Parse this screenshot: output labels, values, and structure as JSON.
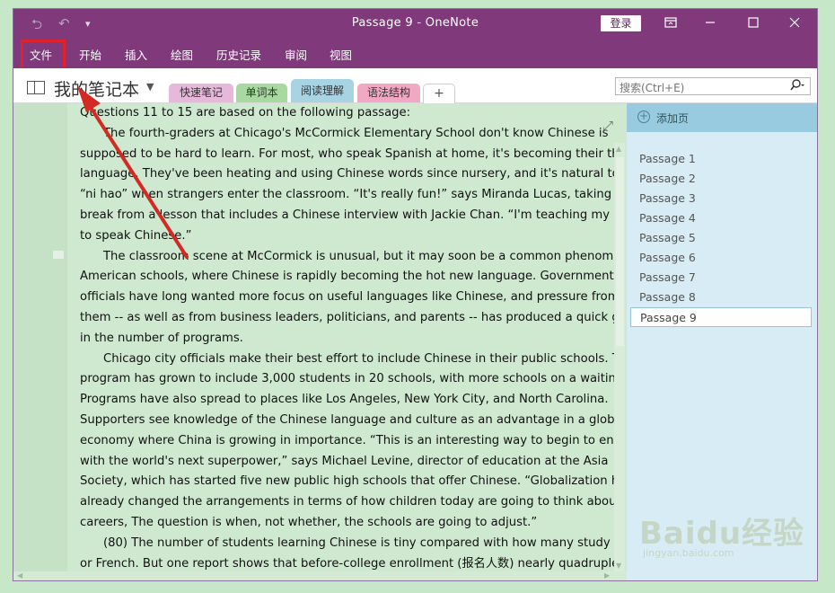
{
  "titlebar": {
    "title": "Passage 9  -  OneNote",
    "login": "登录",
    "back_icon": "back-arrow-icon",
    "undo_icon": "undo-icon"
  },
  "ribbon": {
    "tabs": [
      "文件",
      "开始",
      "插入",
      "绘图",
      "历史记录",
      "审阅",
      "视图"
    ]
  },
  "notebook": {
    "name": "我的笔记本",
    "sections": [
      {
        "label": "快速笔记",
        "color": "#e5b8dc"
      },
      {
        "label": "单词本",
        "color": "#a8d9a0"
      },
      {
        "label": "阅读理解",
        "color": "#a7d3e3"
      },
      {
        "label": "语法结构",
        "color": "#f1a9c3"
      }
    ],
    "add_section": "+"
  },
  "search": {
    "placeholder": "搜索(Ctrl+E)"
  },
  "content": {
    "lines": [
      {
        "text": "Questions 11 to 15 are based on the following passage:",
        "indent": false
      },
      {
        "text": "The fourth-graders at Chicago's McCormick Elementary School don't know Chinese is",
        "indent": true
      },
      {
        "text": "supposed to be hard to learn. For most, who speak Spanish at home, it's becoming their third",
        "indent": false
      },
      {
        "text": "language. They've been heating and using Chinese words since nursery, and it's natural to give",
        "indent": false
      },
      {
        "text": " “ni hao” when strangers enter the classroom. “It's really fun!”  says Miranda Lucas, taking a",
        "indent": false
      },
      {
        "text": "break from a lesson that includes a Chinese interview with Jackie Chan. “I'm teaching my mom",
        "indent": false
      },
      {
        "text": "to speak Chinese.”",
        "indent": false
      },
      {
        "text": "The classroom scene at McCormick is unusual, but it may soon be a common phenomenon in",
        "indent": true
      },
      {
        "text": "American schools, where Chinese is rapidly becoming the hot new language. Government",
        "indent": false
      },
      {
        "text": "officials have long wanted more focus on useful languages like Chinese, and pressure from",
        "indent": false
      },
      {
        "text": "them -- as well as from business leaders, politicians, and parents -- has produced a quick growth",
        "indent": false
      },
      {
        "text": "in the number of programs.",
        "indent": false
      },
      {
        "text": "Chicago city officials make their best effort to include Chinese in their public schools. The",
        "indent": true
      },
      {
        "text": "program has grown to include 3,000 students in 20 schools, with more schools on a waiting list.",
        "indent": false
      },
      {
        "text": "Programs have also spread to places like Los Angeles, New York City, and North Carolina.",
        "indent": false
      },
      {
        "text": "Supporters see knowledge of the Chinese language and culture as an advantage in a global",
        "indent": false
      },
      {
        "text": "economy where China is growing in importance. “This is an interesting way to begin to engage",
        "indent": false
      },
      {
        "text": "with the world's next superpower,”  says Michael Levine, director of education at the Asia",
        "indent": false
      },
      {
        "text": "Society, which has started five new public high schools that offer Chinese. “Globalization has",
        "indent": false
      },
      {
        "text": "already changed the arrangements in terms of how children today are going to think about their",
        "indent": false
      },
      {
        "text": "careers, The question is when, not whether, the schools are going to adjust.”",
        "indent": false
      },
      {
        "text": "(80) The number of students learning Chinese is tiny compared with how many study Spanish",
        "indent": true
      },
      {
        "text": "or French. But one report shows that before-college enrollment (报名人数) nearly quadrupled",
        "indent": false
      }
    ]
  },
  "pages": {
    "add_label": "添加页",
    "items": [
      "Passage 1",
      "Passage 2",
      "Passage 3",
      "Passage 4",
      "Passage 5",
      "Passage 6",
      "Passage 7",
      "Passage 8",
      "Passage 9"
    ],
    "active": "Passage 9"
  },
  "watermark": {
    "logo": "Baidu经验",
    "url": "jingyan.baidu.com"
  },
  "colors": {
    "accent": "#80397b",
    "annotation": "#e0202a"
  }
}
